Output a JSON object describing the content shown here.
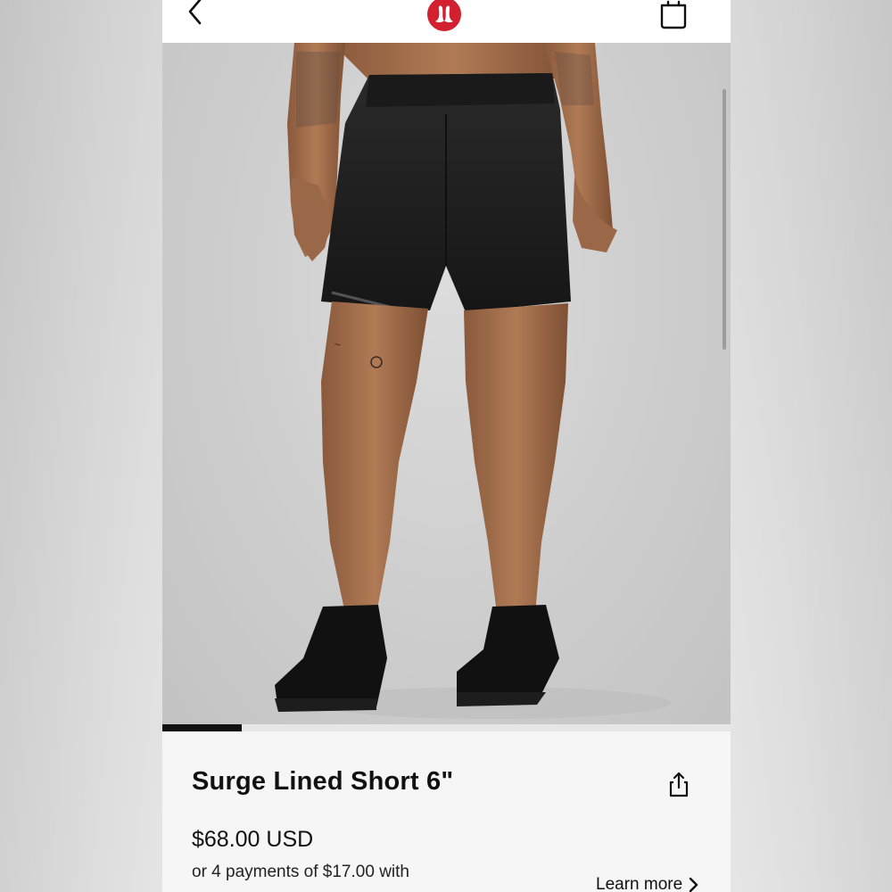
{
  "header": {
    "back_icon": "chevron-left-icon",
    "logo_icon": "lululemon-logo",
    "bag_icon": "shopping-bag-icon"
  },
  "gallery": {
    "image_alt": "Man wearing black Surge Lined Short 6\" with black sneakers",
    "current_index": 1,
    "progress_fraction": 0.14
  },
  "product": {
    "title": "Surge Lined Short 6\"",
    "price": "$68.00 USD",
    "installments": "or 4 payments of $17.00 with",
    "learn_more": "Learn more",
    "share_icon": "share-icon"
  },
  "colors": {
    "brand_red": "#d22030",
    "text": "#111111",
    "background": "#ffffff"
  }
}
